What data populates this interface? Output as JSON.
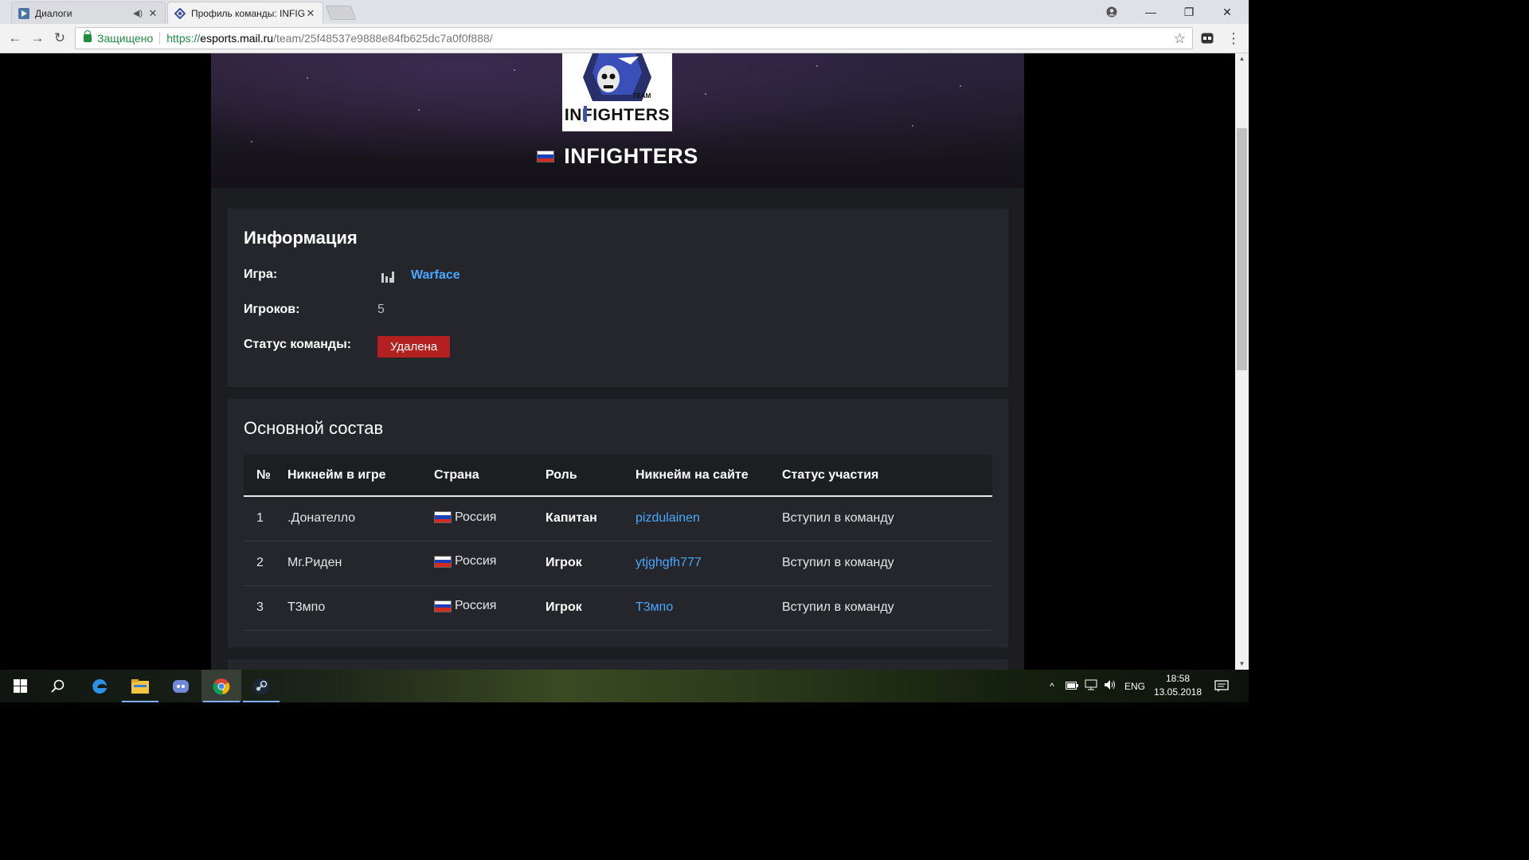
{
  "browser": {
    "tabs": [
      {
        "title": "Диалоги",
        "active": false,
        "has_audio": true
      },
      {
        "title": "Профиль команды: INFIGHTERS",
        "active": true,
        "has_audio": false
      }
    ],
    "secure_label": "Защищено",
    "url_scheme": "https://",
    "url_host": "esports.mail.ru",
    "url_path": "/team/25f48537e9888e84fb625dc7a0f0f888/"
  },
  "team": {
    "name": "INFIGHTERS",
    "logo_text": "INFIGHTERS",
    "logo_small_text": "TEAM"
  },
  "info": {
    "heading": "Информация",
    "game_label": "Игра:",
    "game_value": "Warface",
    "players_label": "Игроков:",
    "players_value": "5",
    "status_label": "Статус команды:",
    "status_value": "Удалена",
    "status_color": "#b2201f"
  },
  "roster": {
    "heading": "Основной состав",
    "columns": [
      "№",
      "Никнейм в игре",
      "Страна",
      "Роль",
      "Никнейм на сайте",
      "Статус участия"
    ],
    "rows": [
      {
        "num": "1",
        "nickname": ".Донателло",
        "country": "Россия",
        "role": "Капитан",
        "site_nick": "pizdulainen",
        "status": "Вступил в команду"
      },
      {
        "num": "2",
        "nickname": "Мг.Риден",
        "country": "Россия",
        "role": "Игрок",
        "site_nick": "ytjghgfh777",
        "status": "Вступил в команду"
      },
      {
        "num": "3",
        "nickname": "T3мпо",
        "country": "Россия",
        "role": "Игрок",
        "site_nick": "T3мпо",
        "status": "Вступил в команду"
      }
    ]
  },
  "taskbar": {
    "apps": [
      "windows-start",
      "search",
      "edge",
      "file-explorer",
      "discord",
      "chrome",
      "steam"
    ],
    "active_app": "chrome",
    "language": "ENG",
    "time": "18:58",
    "date": "13.05.2018"
  },
  "colors": {
    "link": "#4aa8ff",
    "card": "#25262b",
    "page": "#1c1d21"
  }
}
